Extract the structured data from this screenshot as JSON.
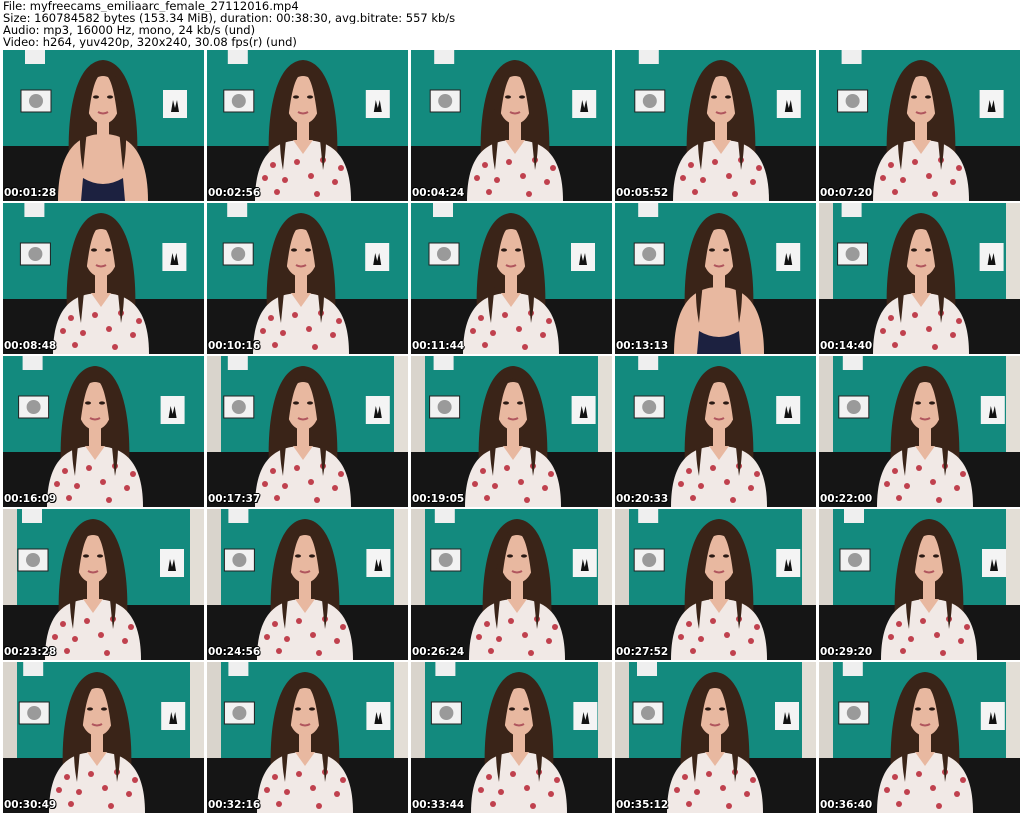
{
  "header": {
    "file_line": "File: myfreecams_emiliaarc_female_27112016.mp4",
    "size_line": "Size: 160784582 bytes (153.34 MiB), duration: 00:38:30, avg.bitrate: 557 kb/s",
    "audio_line": "Audio: mp3, 16000 Hz, mono, 24 kb/s (und)",
    "video_line": "Video: h264, yuv420p, 320x240, 30.08 fps(r) (und)"
  },
  "colors": {
    "wall": "#138a7e",
    "couch": "#151515",
    "hair": "#3a2418",
    "skin": "#e8b8a0",
    "dress": "#f1e9e6",
    "pattern": "#c0414e"
  },
  "thumbnails": [
    {
      "timestamp": "00:01:28"
    },
    {
      "timestamp": "00:02:56"
    },
    {
      "timestamp": "00:04:24"
    },
    {
      "timestamp": "00:05:52"
    },
    {
      "timestamp": "00:07:20"
    },
    {
      "timestamp": "00:08:48"
    },
    {
      "timestamp": "00:10:16"
    },
    {
      "timestamp": "00:11:44"
    },
    {
      "timestamp": "00:13:13"
    },
    {
      "timestamp": "00:14:40"
    },
    {
      "timestamp": "00:16:09"
    },
    {
      "timestamp": "00:17:37"
    },
    {
      "timestamp": "00:19:05"
    },
    {
      "timestamp": "00:20:33"
    },
    {
      "timestamp": "00:22:00"
    },
    {
      "timestamp": "00:23:28"
    },
    {
      "timestamp": "00:24:56"
    },
    {
      "timestamp": "00:26:24"
    },
    {
      "timestamp": "00:27:52"
    },
    {
      "timestamp": "00:29:20"
    },
    {
      "timestamp": "00:30:49"
    },
    {
      "timestamp": "00:32:16"
    },
    {
      "timestamp": "00:33:44"
    },
    {
      "timestamp": "00:35:12"
    },
    {
      "timestamp": "00:36:40"
    }
  ]
}
